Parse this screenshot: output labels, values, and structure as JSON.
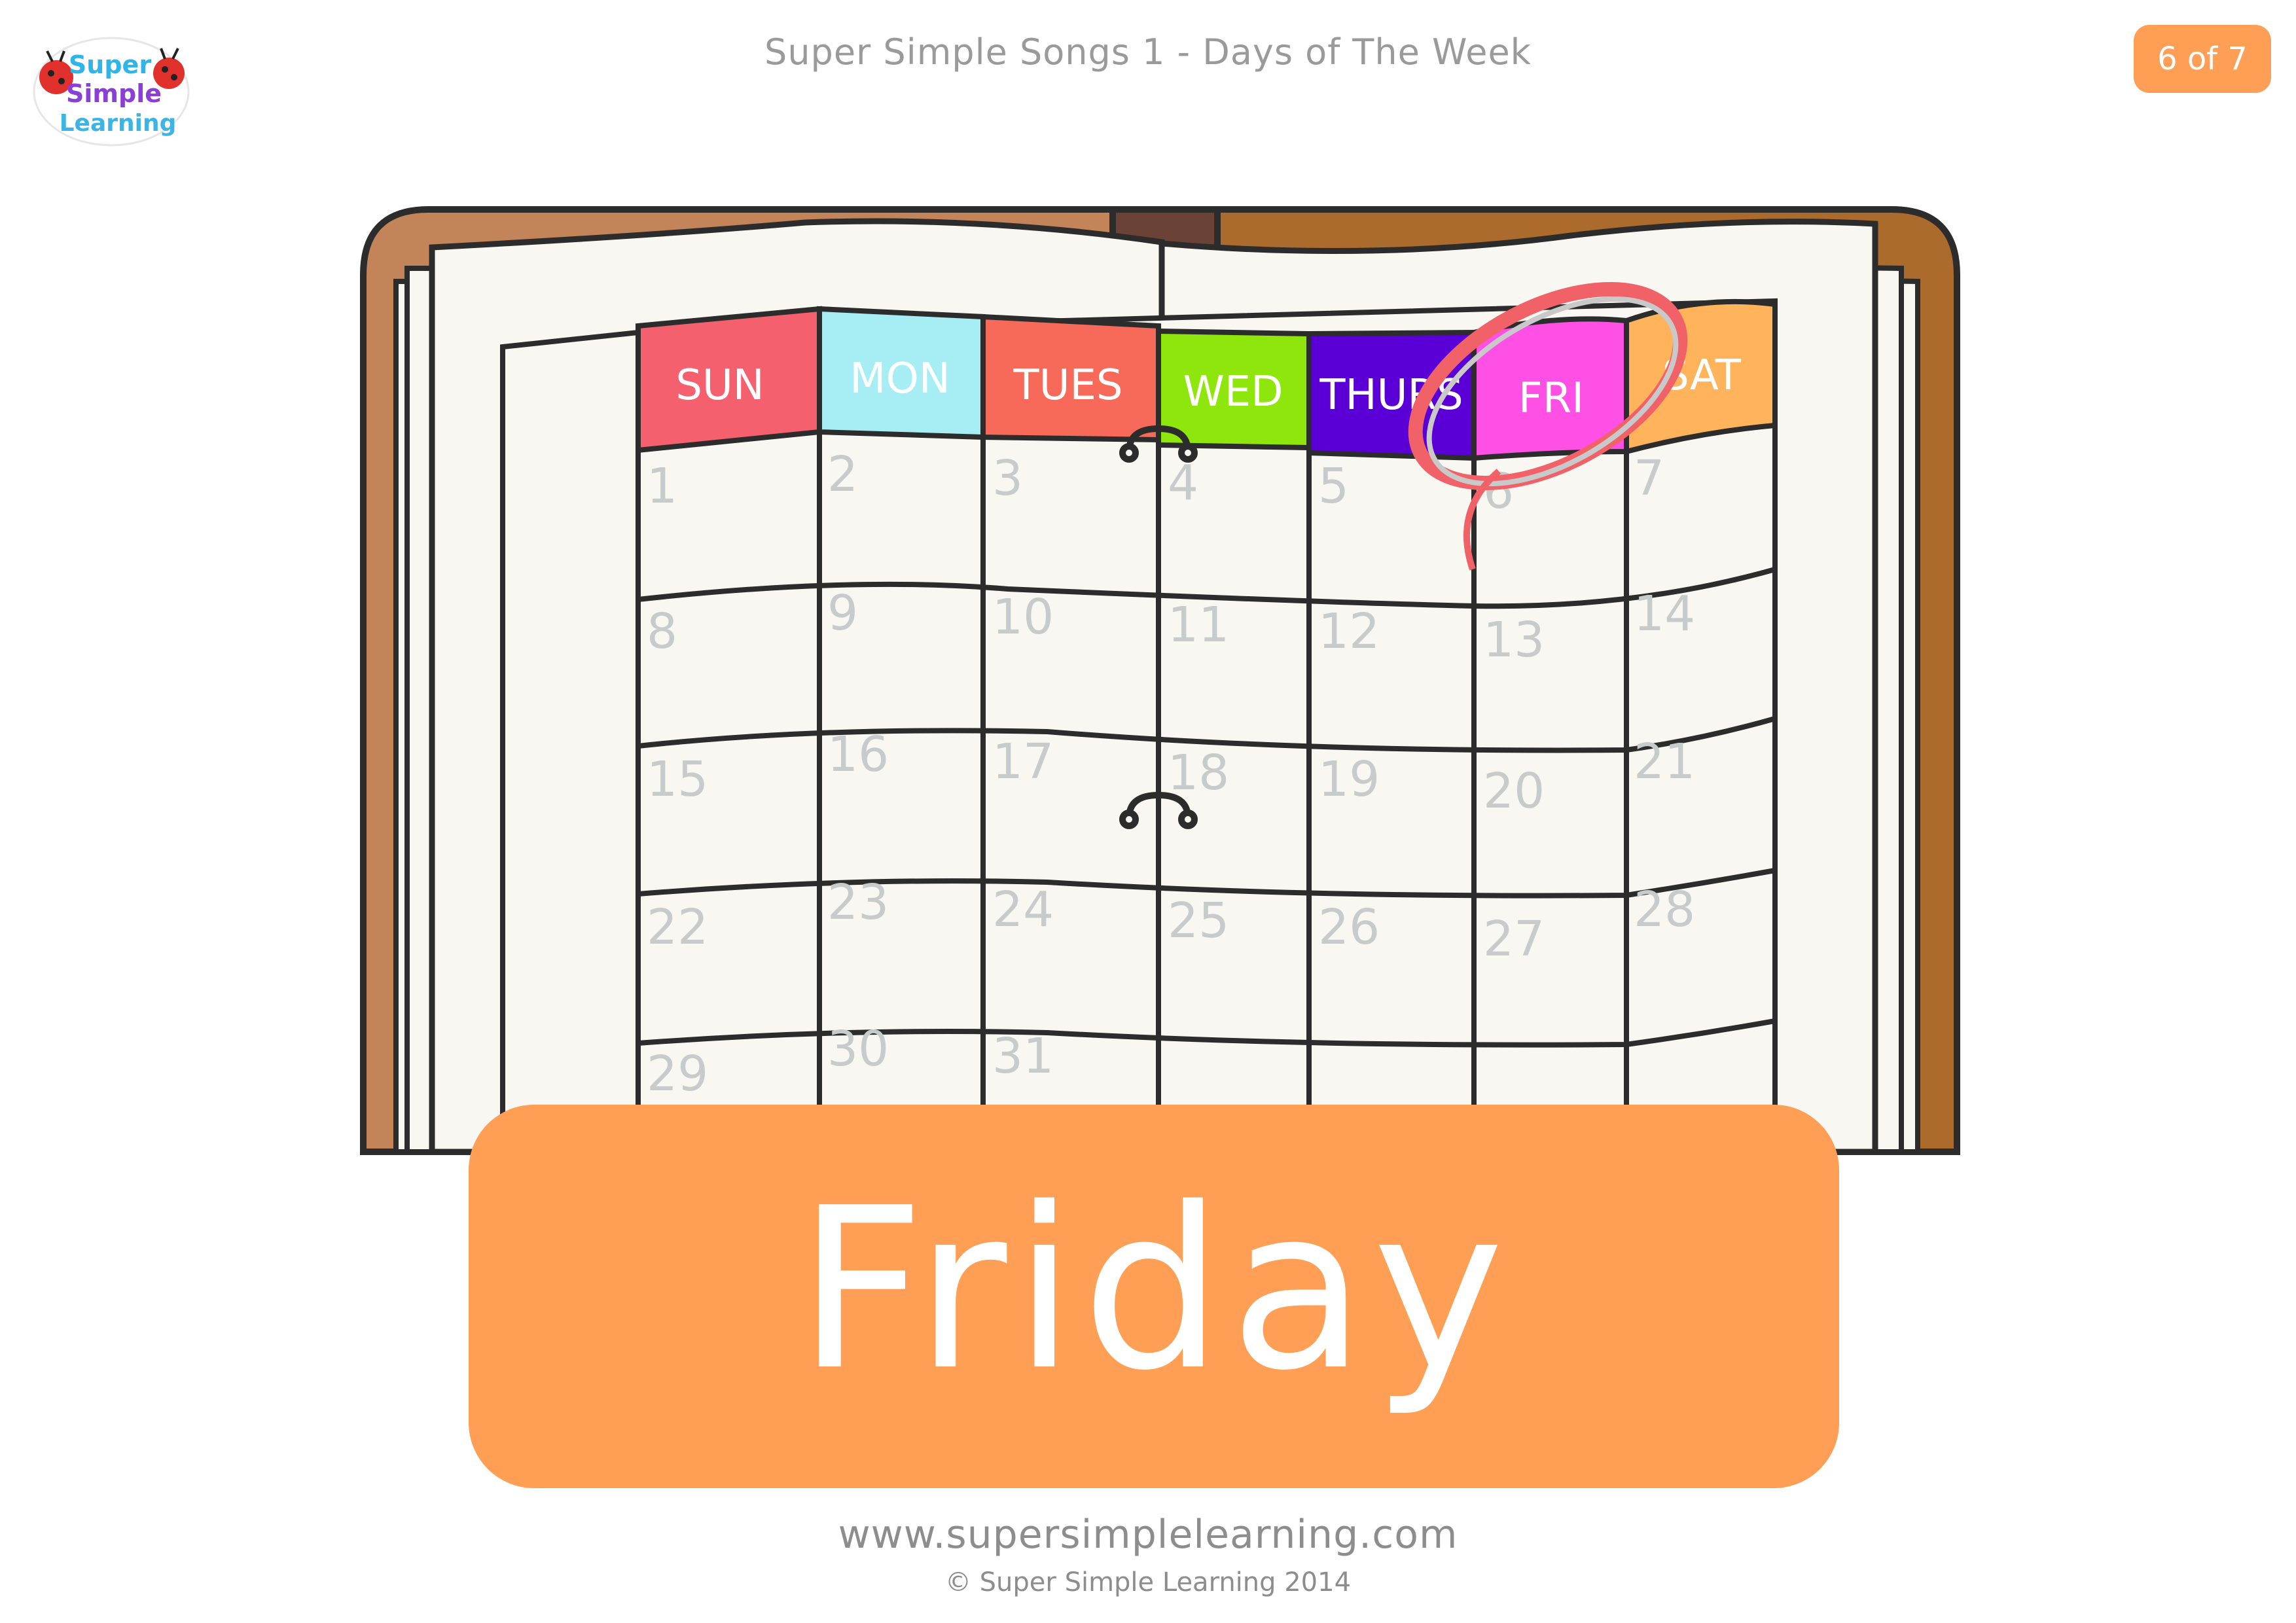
{
  "header": {
    "title": "Super Simple Songs 1 -  Days of The Week",
    "page_indicator": "6 of 7"
  },
  "logo": {
    "line1": "Super",
    "line2": "Simple",
    "line3": "Learning",
    "colors": {
      "super": "#2fb5e8",
      "simple": "#8a3fd6",
      "learning": "#3cb4e6"
    }
  },
  "calendar": {
    "days": [
      {
        "label": "SUN",
        "color": "#f5606f"
      },
      {
        "label": "MON",
        "color": "#a6eef4"
      },
      {
        "label": "TUES",
        "color": "#f76958"
      },
      {
        "label": "WED",
        "color": "#8ee60c"
      },
      {
        "label": "THURS",
        "color": "#5a00d6"
      },
      {
        "label": "FRI",
        "color": "#ff50e6"
      },
      {
        "label": "SAT",
        "color": "#ffb35a"
      }
    ],
    "highlighted_day": "FRI",
    "circle_color": "#f06168",
    "numbers": [
      "1",
      "2",
      "3",
      "4",
      "5",
      "6",
      "7",
      "8",
      "9",
      "10",
      "11",
      "12",
      "13",
      "14",
      "15",
      "16",
      "17",
      "18",
      "19",
      "20",
      "21",
      "22",
      "23",
      "24",
      "25",
      "26",
      "27",
      "28",
      "29",
      "30",
      "31"
    ]
  },
  "banner": {
    "word": "Friday",
    "color": "#ff9f56"
  },
  "footer": {
    "url": "www.supersimplelearning.com",
    "copyright": "© Super Simple Learning 2014"
  }
}
